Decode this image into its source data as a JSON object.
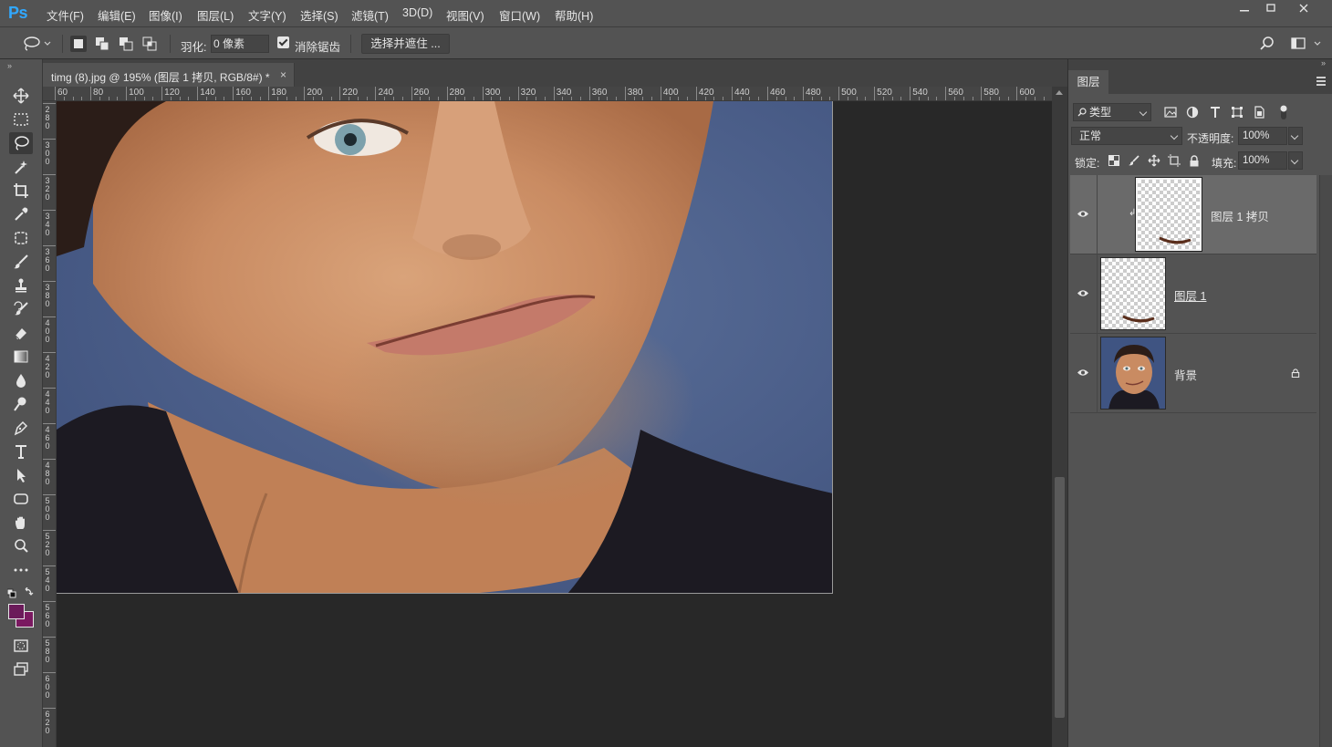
{
  "app": {
    "logo": "Ps"
  },
  "menu": [
    "文件(F)",
    "编辑(E)",
    "图像(I)",
    "图层(L)",
    "文字(Y)",
    "选择(S)",
    "滤镜(T)",
    "3D(D)",
    "视图(V)",
    "窗口(W)",
    "帮助(H)"
  ],
  "options": {
    "feather_label": "羽化:",
    "feather_value": "0 像素",
    "antialias_label": "消除锯齿",
    "select_mask_label": "选择并遮住 ..."
  },
  "document": {
    "tab_title": "timg (8).jpg @ 195% (图层 1 拷贝, RGB/8#) *",
    "close_glyph": "×"
  },
  "ruler": {
    "h_labels": [
      "60",
      "80",
      "100",
      "120",
      "140",
      "160",
      "180",
      "200",
      "220",
      "240",
      "260",
      "280",
      "300",
      "320",
      "340",
      "360",
      "380",
      "400",
      "420",
      "440",
      "460",
      "480",
      "500",
      "520",
      "540",
      "560",
      "580",
      "600"
    ],
    "v_labels": [
      "280",
      "300",
      "320",
      "340",
      "360",
      "380",
      "400",
      "420",
      "440",
      "460",
      "480",
      "500",
      "520",
      "540",
      "560",
      "580",
      "600",
      "620"
    ]
  },
  "layers_panel": {
    "tab_label": "图层",
    "filter_kind": "类型",
    "blend_mode": "正常",
    "opacity_label": "不透明度:",
    "opacity_value": "100%",
    "lock_label": "锁定:",
    "fill_label": "填充:",
    "fill_value": "100%",
    "layers": [
      {
        "name": "图层 1 拷贝",
        "selected": true,
        "clipped": true
      },
      {
        "name": "图层 1",
        "selected": false
      },
      {
        "name": "背景",
        "selected": false,
        "locked": true
      }
    ]
  },
  "colors": {
    "foreground": "#6b1b5a",
    "background": "#7a1960",
    "accent": "#31a8ff"
  }
}
